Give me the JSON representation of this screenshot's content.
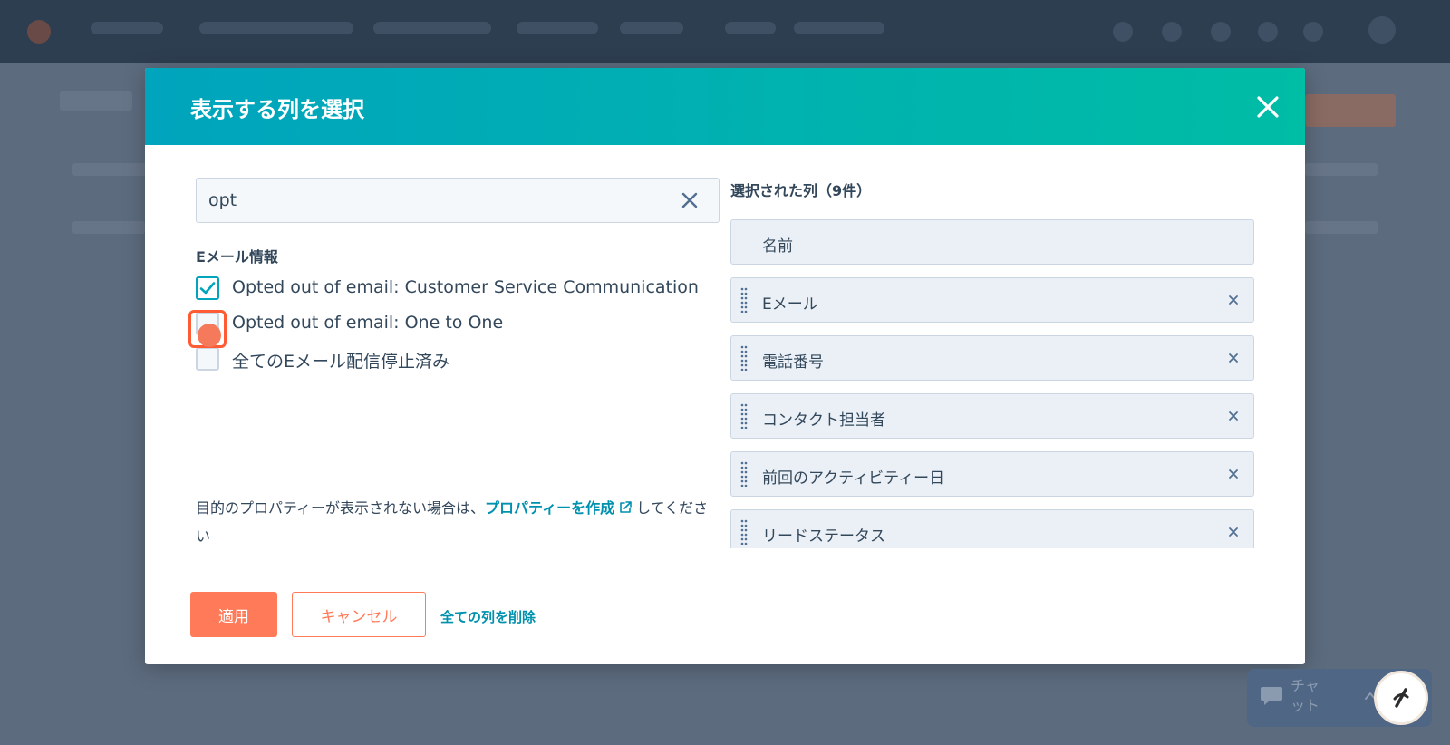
{
  "modal": {
    "title": "表示する列を選択",
    "search": {
      "value": "opt",
      "placeholder": ""
    },
    "group_label": "Eメール情報",
    "options": [
      {
        "label": "Opted out of email: Customer Service Communication",
        "checked": true
      },
      {
        "label": "Opted out of email: One to One",
        "checked": false
      },
      {
        "label": "全てのEメール配信停止済み",
        "checked": false
      }
    ],
    "help": {
      "prefix": "目的のプロパティーが表示されない場合は、",
      "link": "プロパティーを作成",
      "suffix": "してください"
    },
    "selected": {
      "title": "選択された列（9件）",
      "items": [
        "名前",
        "Eメール",
        "電話番号",
        "コンタクト担当者",
        "前回のアクティビティー日",
        "リードステータス"
      ]
    },
    "footer": {
      "apply": "適用",
      "cancel": "キャンセル",
      "remove_all": "全ての列を削除"
    }
  },
  "chat": {
    "label": "チャット"
  },
  "colors": {
    "header_start": "#00a4bd",
    "header_end": "#00bda5",
    "primary": "#ff7a59",
    "link": "#0091ae"
  }
}
